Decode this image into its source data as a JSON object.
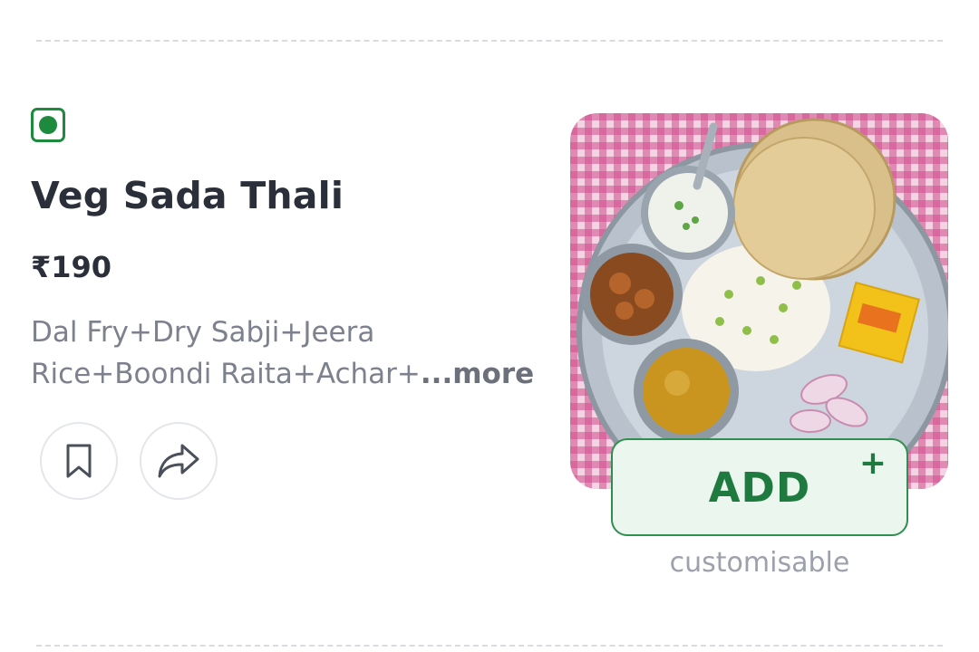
{
  "item": {
    "veg_indicator_icon": "veg-indicator-icon",
    "name": "Veg Sada Thali",
    "price": "₹190",
    "description_line1": "Dal Fry+Dry Sabji+Jeera",
    "description_line2": "Rice+Boondi Raita+Achar+",
    "more_label": "...more",
    "image_label": "Veg Sada Thali dish photo"
  },
  "actions": {
    "bookmark_icon": "bookmark-icon",
    "share_icon": "share-icon",
    "add_label": "ADD",
    "add_plus": "+",
    "customisable_note": "customisable"
  },
  "colors": {
    "veg_green": "#1e8a3e",
    "add_button_bg": "#eaf6ee",
    "add_button_text": "#1e7a3e",
    "title_text": "#2a2f3a",
    "description_text": "#7c818d"
  }
}
